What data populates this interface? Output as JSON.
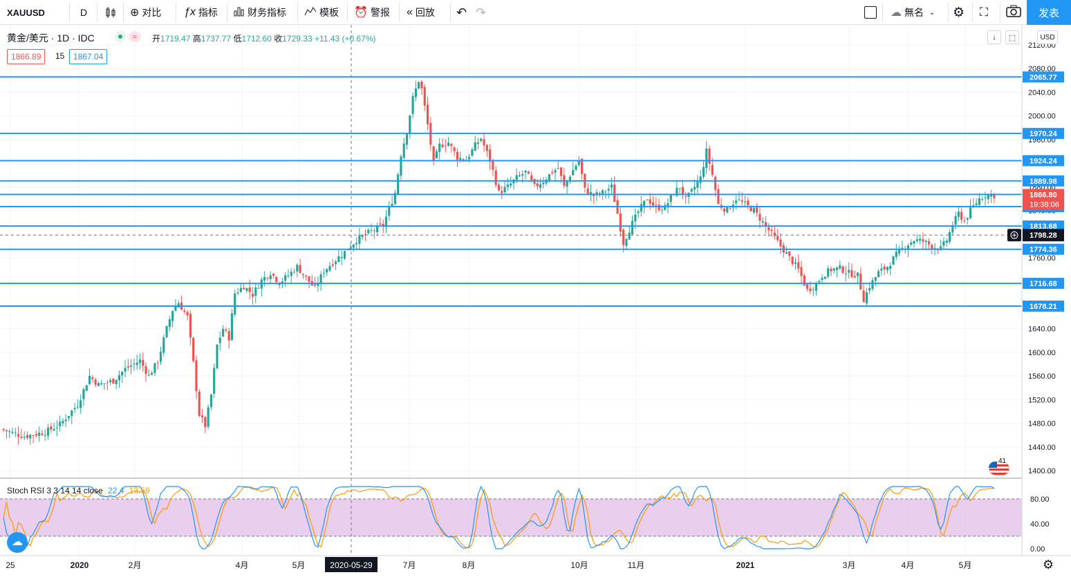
{
  "toolbar": {
    "symbol": "XAUUSD",
    "interval": "D",
    "compare": "对比",
    "indicators": "指标",
    "financials": "财务指标",
    "templates": "模板",
    "alert": "警报",
    "replay": "回放",
    "layout_name": "無名",
    "publish": "发表"
  },
  "legend": {
    "title": "黄金/美元 · 1D · IDC",
    "open_label": "开",
    "open": "1719.47",
    "high_label": "高",
    "high": "1737.77",
    "low_label": "低",
    "low": "1712.60",
    "close_label": "收",
    "close": "1729.33",
    "change": "+11.43 (+0.67%)",
    "bid": "1866.89",
    "spread": "15",
    "ask": "1867.04"
  },
  "currency": "USD",
  "crosshair": {
    "date": "2020-05-29",
    "price": "1798.28"
  },
  "countdown": "19:38:06",
  "flag_badge": "41",
  "colors": {
    "up": "#26a69a",
    "down": "#ef5350",
    "hline": "#2196f3",
    "accent": "#2196f3",
    "stoch_fill": "#e1bee7"
  },
  "chart_data": {
    "type": "candlestick",
    "symbol": "XAUUSD",
    "ylim": [
      1380,
      2130
    ],
    "price_ticks": [
      "2120.00",
      "2080.00",
      "2040.00",
      "2000.00",
      "1960.00",
      "1920.00",
      "1880.00",
      "1840.00",
      "1800.00",
      "1760.00",
      "1720.00",
      "1680.00",
      "1640.00",
      "1600.00",
      "1560.00",
      "1520.00",
      "1480.00",
      "1440.00",
      "1400.00"
    ],
    "x_ticks": [
      "25",
      "2020",
      "2月",
      "4月",
      "5月",
      "7月",
      "8月",
      "10月",
      "11月",
      "2021",
      "3月",
      "4月",
      "5月"
    ],
    "horizontal_levels": [
      {
        "value": 2065.77,
        "label": "2065.77"
      },
      {
        "value": 1970.24,
        "label": "1970.24"
      },
      {
        "value": 1924.24,
        "label": "1924.24"
      },
      {
        "value": 1889.98,
        "label": "1889.98"
      },
      {
        "value": 1867.05,
        "label": "1867.05"
      },
      {
        "value": 1846.46,
        "label": "1846.46"
      },
      {
        "value": 1813.68,
        "label": "1813.68"
      },
      {
        "value": 1774.36,
        "label": "1774.36"
      },
      {
        "value": 1716.68,
        "label": "1716.68"
      },
      {
        "value": 1678.21,
        "label": "1678.21"
      }
    ],
    "last_price": {
      "value": 1866.8,
      "label": "1866.80"
    },
    "price_path": [
      [
        0,
        1470
      ],
      [
        8,
        1458
      ],
      [
        15,
        1465
      ],
      [
        20,
        1478
      ],
      [
        26,
        1512
      ],
      [
        30,
        1560
      ],
      [
        33,
        1545
      ],
      [
        38,
        1552
      ],
      [
        42,
        1572
      ],
      [
        47,
        1586
      ],
      [
        50,
        1560
      ],
      [
        53,
        1585
      ],
      [
        56,
        1640
      ],
      [
        58,
        1672
      ],
      [
        60,
        1684
      ],
      [
        63,
        1660
      ],
      [
        65,
        1582
      ],
      [
        67,
        1495
      ],
      [
        69,
        1476
      ],
      [
        71,
        1528
      ],
      [
        73,
        1612
      ],
      [
        75,
        1640
      ],
      [
        77,
        1625
      ],
      [
        79,
        1700
      ],
      [
        82,
        1712
      ],
      [
        85,
        1698
      ],
      [
        88,
        1722
      ],
      [
        91,
        1735
      ],
      [
        94,
        1718
      ],
      [
        97,
        1730
      ],
      [
        100,
        1745
      ],
      [
        103,
        1726
      ],
      [
        106,
        1708
      ],
      [
        109,
        1738
      ],
      [
        112,
        1752
      ],
      [
        116,
        1770
      ],
      [
        120,
        1790
      ],
      [
        125,
        1805
      ],
      [
        129,
        1815
      ],
      [
        133,
        1870
      ],
      [
        135,
        1935
      ],
      [
        137,
        1975
      ],
      [
        139,
        2030
      ],
      [
        141,
        2060
      ],
      [
        142,
        2045
      ],
      [
        144,
        1985
      ],
      [
        146,
        1920
      ],
      [
        148,
        1950
      ],
      [
        151,
        1955
      ],
      [
        154,
        1930
      ],
      [
        157,
        1925
      ],
      [
        160,
        1950
      ],
      [
        162,
        1962
      ],
      [
        165,
        1925
      ],
      [
        168,
        1870
      ],
      [
        171,
        1880
      ],
      [
        174,
        1895
      ],
      [
        177,
        1905
      ],
      [
        180,
        1880
      ],
      [
        183,
        1890
      ],
      [
        186,
        1905
      ],
      [
        188,
        1912
      ],
      [
        190,
        1880
      ],
      [
        192,
        1900
      ],
      [
        195,
        1925
      ],
      [
        197,
        1875
      ],
      [
        200,
        1865
      ],
      [
        203,
        1870
      ],
      [
        206,
        1880
      ],
      [
        208,
        1835
      ],
      [
        210,
        1785
      ],
      [
        212,
        1808
      ],
      [
        215,
        1838
      ],
      [
        218,
        1860
      ],
      [
        221,
        1845
      ],
      [
        224,
        1845
      ],
      [
        227,
        1870
      ],
      [
        229,
        1880
      ],
      [
        231,
        1858
      ],
      [
        233,
        1872
      ],
      [
        236,
        1895
      ],
      [
        238,
        1940
      ],
      [
        240,
        1900
      ],
      [
        242,
        1850
      ],
      [
        245,
        1840
      ],
      [
        248,
        1860
      ],
      [
        251,
        1850
      ],
      [
        254,
        1840
      ],
      [
        257,
        1820
      ],
      [
        260,
        1800
      ],
      [
        263,
        1780
      ],
      [
        266,
        1760
      ],
      [
        269,
        1740
      ],
      [
        272,
        1705
      ],
      [
        275,
        1715
      ],
      [
        277,
        1730
      ],
      [
        280,
        1740
      ],
      [
        283,
        1742
      ],
      [
        286,
        1734
      ],
      [
        289,
        1730
      ],
      [
        291,
        1690
      ],
      [
        293,
        1712
      ],
      [
        296,
        1735
      ],
      [
        299,
        1745
      ],
      [
        302,
        1765
      ],
      [
        305,
        1780
      ],
      [
        308,
        1790
      ],
      [
        311,
        1788
      ],
      [
        314,
        1780
      ],
      [
        317,
        1775
      ],
      [
        319,
        1790
      ],
      [
        321,
        1815
      ],
      [
        323,
        1835
      ],
      [
        325,
        1822
      ],
      [
        327,
        1840
      ],
      [
        330,
        1860
      ],
      [
        332,
        1866
      ]
    ],
    "stoch_rsi": {
      "name": "Stoch RSI 3 3 14 14 close",
      "k": 22.4,
      "d": 13.59,
      "ticks": [
        "80.00",
        "40.00",
        "0.00"
      ],
      "bands": [
        20,
        80
      ]
    }
  }
}
